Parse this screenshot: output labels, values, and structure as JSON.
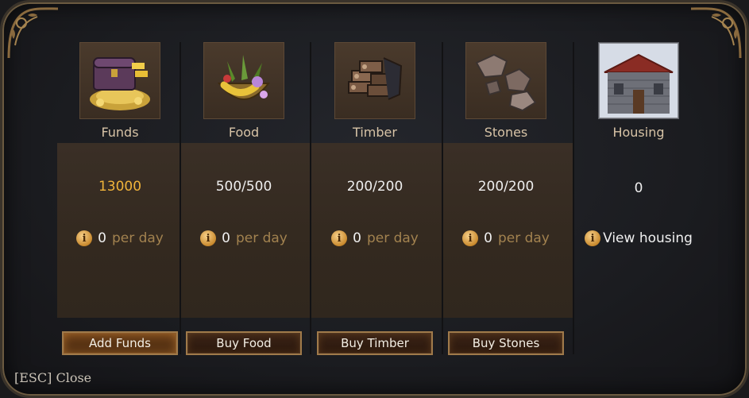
{
  "resources": [
    {
      "name": "Funds",
      "icon": "treasure-chest-icon",
      "value": "13000",
      "value_color": "#f0b43a",
      "rate": "0",
      "per_day": "per day",
      "button": "Add Funds"
    },
    {
      "name": "Food",
      "icon": "food-basket-icon",
      "value": "500/500",
      "value_color": "#eeeeee",
      "rate": "0",
      "per_day": "per day",
      "button": "Buy Food"
    },
    {
      "name": "Timber",
      "icon": "timber-logs-icon",
      "value": "200/200",
      "value_color": "#eeeeee",
      "rate": "0",
      "per_day": "per day",
      "button": "Buy Timber"
    },
    {
      "name": "Stones",
      "icon": "stones-icon",
      "value": "200/200",
      "value_color": "#eeeeee",
      "rate": "0",
      "per_day": "per day",
      "button": "Buy Stones"
    }
  ],
  "housing": {
    "label": "Housing",
    "icon": "house-icon",
    "value": "0",
    "link": "View housing"
  },
  "info_glyph": "i",
  "close": "[ESC] Close",
  "colors": {
    "accent_gold": "#f0b43a",
    "per_day": "#a2824f",
    "button_border": "#a07a4a",
    "band": "#352a20"
  }
}
